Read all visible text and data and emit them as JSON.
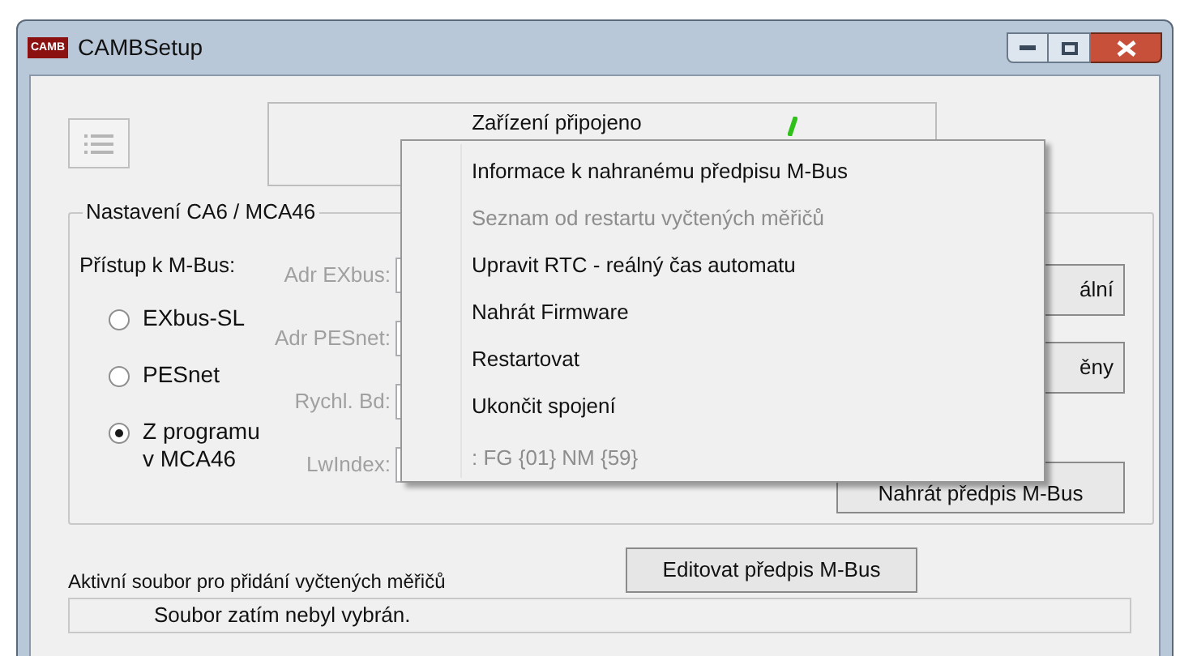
{
  "window": {
    "title": "CAMBSetup",
    "icon_text": "CAMB"
  },
  "status": {
    "text": "Zařízení připojeno"
  },
  "group": {
    "title": "Nastavení CA6 / MCA46",
    "access_label": "Přístup k M-Bus:",
    "radios": [
      {
        "label": "EXbus-SL",
        "selected": false
      },
      {
        "label": "PESnet",
        "selected": false
      },
      {
        "label": "Z programu v MCA46",
        "selected": true
      }
    ],
    "fields": [
      {
        "label": "Adr EXbus:",
        "disabled": true
      },
      {
        "label": "Adr PESnet:",
        "disabled": true
      },
      {
        "label": "Rychl. Bd:",
        "disabled": true
      },
      {
        "label": "LwIndex:",
        "disabled": true
      }
    ],
    "buttons": [
      "ální",
      "ěny",
      "Nahrát předpis M-Bus"
    ]
  },
  "menu": {
    "items": [
      {
        "label": "Informace k nahranému předpisu M-Bus",
        "disabled": false
      },
      {
        "label": "Seznam od restartu vyčtených měřičů",
        "disabled": true
      },
      {
        "label": "Upravit RTC - reálný čas automatu",
        "disabled": false
      },
      {
        "label": "Nahrát Firmware",
        "disabled": false
      },
      {
        "label": "Restartovat",
        "disabled": false
      },
      {
        "label": "Ukončit spojení",
        "disabled": false
      }
    ],
    "footer": ": FG {01} NM {59}"
  },
  "edit_button": "Editovat předpis M-Bus",
  "active_file": {
    "label": "Aktivní soubor pro přidání vyčtených měřičů",
    "value": "Soubor zatím nebyl vybrán."
  }
}
